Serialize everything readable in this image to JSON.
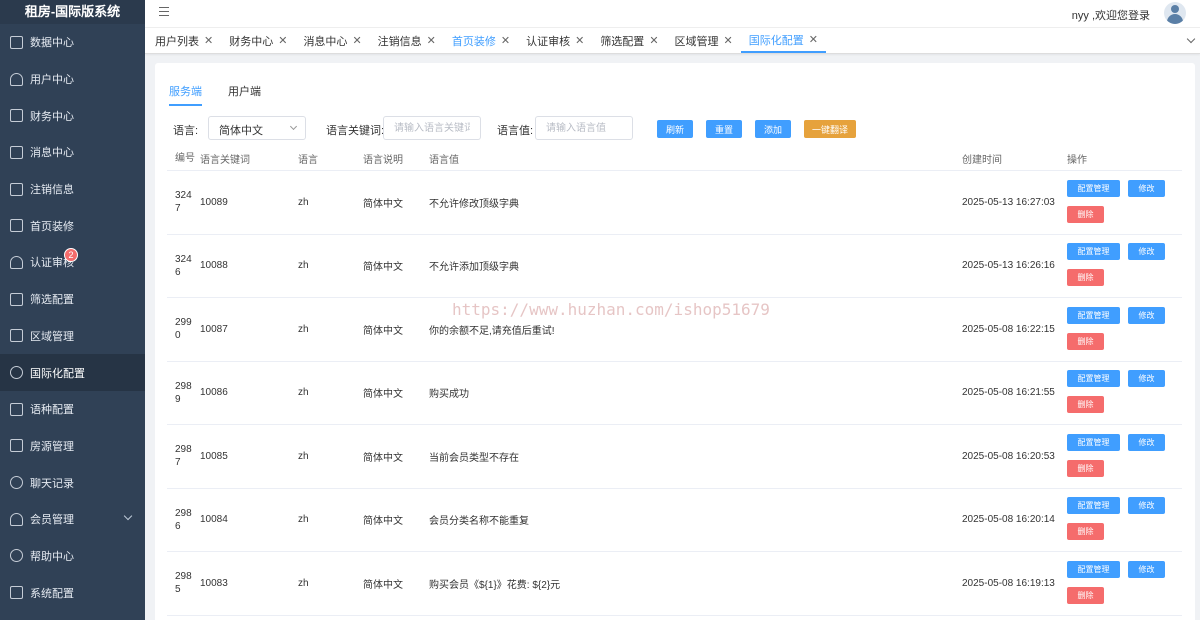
{
  "app": {
    "title": "租房-国际版系统"
  },
  "sidebar": {
    "items": [
      {
        "label": "数据中心",
        "icon": "dashboard-icon"
      },
      {
        "label": "用户中心",
        "icon": "user-icon"
      },
      {
        "label": "财务中心",
        "icon": "wallet-icon"
      },
      {
        "label": "消息中心",
        "icon": "message-icon"
      },
      {
        "label": "注销信息",
        "icon": "clipboard-icon"
      },
      {
        "label": "首页装修",
        "icon": "box-icon"
      },
      {
        "label": "认证审核",
        "icon": "user-check-icon",
        "badge": "2"
      },
      {
        "label": "筛选配置",
        "icon": "filter-doc-icon"
      },
      {
        "label": "区域管理",
        "icon": "map-icon"
      },
      {
        "label": "国际化配置",
        "icon": "globe-icon",
        "active": true
      },
      {
        "label": "语种配置",
        "icon": "language-settings-icon"
      },
      {
        "label": "房源管理",
        "icon": "house-list-icon"
      },
      {
        "label": "聊天记录",
        "icon": "chat-icon"
      },
      {
        "label": "会员管理",
        "icon": "member-icon",
        "expandable": true
      },
      {
        "label": "帮助中心",
        "icon": "help-icon"
      },
      {
        "label": "系统配置",
        "icon": "settings-list-icon"
      }
    ]
  },
  "header": {
    "greeting": "nyy ,欢迎您登录"
  },
  "tabs": [
    {
      "label": "用户列表"
    },
    {
      "label": "财务中心"
    },
    {
      "label": "消息中心"
    },
    {
      "label": "注销信息"
    },
    {
      "label": "首页装修",
      "highlight": true
    },
    {
      "label": "认证审核"
    },
    {
      "label": "筛选配置"
    },
    {
      "label": "区域管理"
    },
    {
      "label": "国际化配置",
      "active": true
    }
  ],
  "subtabs": [
    {
      "label": "服务端",
      "active": true
    },
    {
      "label": "用户端"
    }
  ],
  "filters": {
    "language_label": "语言:",
    "language_value": "简体中文",
    "keyword_label": "语言关键词:",
    "keyword_placeholder": "请输入语言关键词",
    "value_label": "语言值:",
    "value_placeholder": "请输入语言值",
    "refresh": "刷新",
    "reset": "重置",
    "add": "添加",
    "translate": "一键翻译"
  },
  "table": {
    "headers": {
      "id": "编号",
      "key": "语言关键词",
      "lang": "语言",
      "desc": "语言说明",
      "value": "语言值",
      "time": "创建时间",
      "actions": "操作"
    },
    "action_labels": {
      "config": "配置管理",
      "edit": "修改",
      "delete": "删除"
    },
    "rows": [
      {
        "id_1": "324",
        "id_2": "7",
        "key": "10089",
        "lang": "zh",
        "desc": "简体中文",
        "value": "不允许修改顶级字典",
        "time": "2025-05-13 16:27:03"
      },
      {
        "id_1": "324",
        "id_2": "6",
        "key": "10088",
        "lang": "zh",
        "desc": "简体中文",
        "value": "不允许添加顶级字典",
        "time": "2025-05-13 16:26:16"
      },
      {
        "id_1": "299",
        "id_2": "0",
        "key": "10087",
        "lang": "zh",
        "desc": "简体中文",
        "value": "你的余额不足,请充值后重试!",
        "time": "2025-05-08 16:22:15"
      },
      {
        "id_1": "298",
        "id_2": "9",
        "key": "10086",
        "lang": "zh",
        "desc": "简体中文",
        "value": "购买成功",
        "time": "2025-05-08 16:21:55"
      },
      {
        "id_1": "298",
        "id_2": "7",
        "key": "10085",
        "lang": "zh",
        "desc": "简体中文",
        "value": "当前会员类型不存在",
        "time": "2025-05-08 16:20:53"
      },
      {
        "id_1": "298",
        "id_2": "6",
        "key": "10084",
        "lang": "zh",
        "desc": "简体中文",
        "value": "会员分类名称不能重复",
        "time": "2025-05-08 16:20:14"
      },
      {
        "id_1": "298",
        "id_2": "5",
        "key": "10083",
        "lang": "zh",
        "desc": "简体中文",
        "value": "购买会员《${1}》花费: ${2}元",
        "time": "2025-05-08 16:19:13"
      }
    ]
  },
  "watermark": "https://www.huzhan.com/ishop51679"
}
